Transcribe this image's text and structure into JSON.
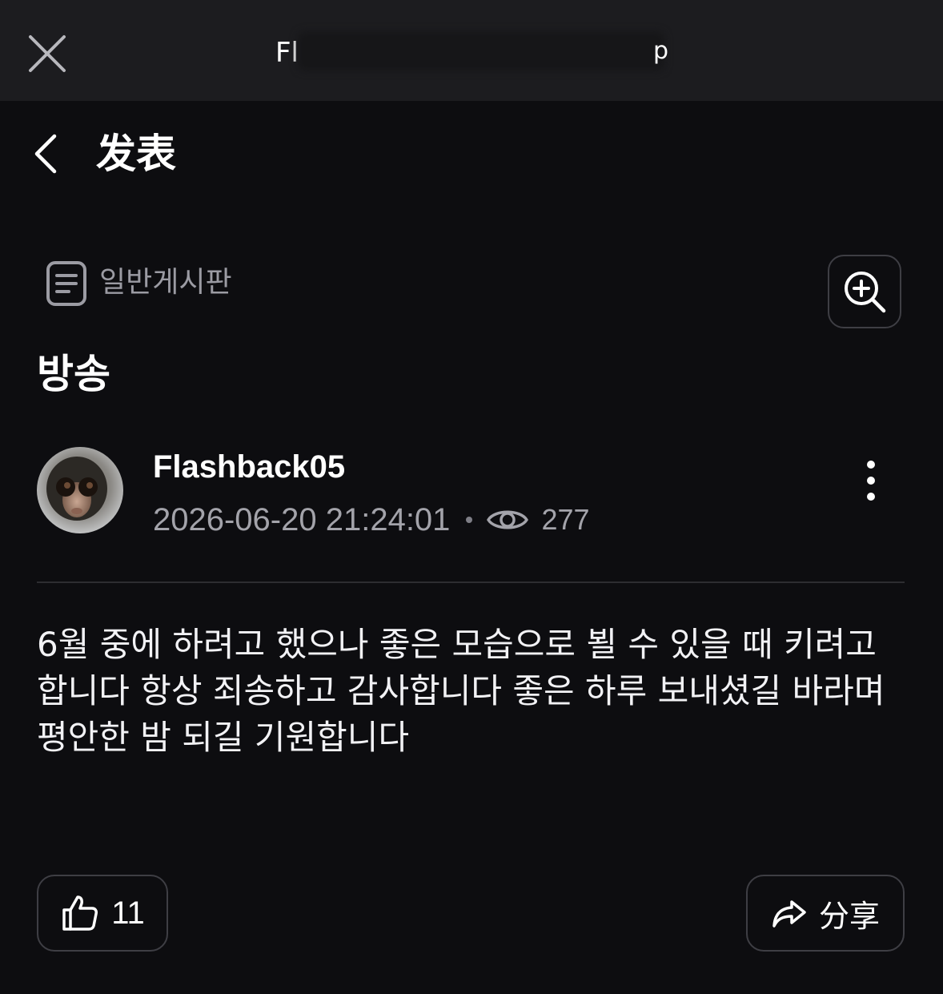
{
  "topbar": {
    "title_visible": "Fl",
    "title_tail": "p"
  },
  "header": {
    "title": "发表"
  },
  "board": {
    "name": "일반게시판"
  },
  "post": {
    "title": "방송",
    "author": "Flashback05",
    "timestamp": "2026-06-20 21:24:01",
    "views": "277",
    "body": "6월 중에 하려고 했으나 좋은 모습으로 뵐 수 있을 때 키려고 합니다 항상 죄송하고 감사합니다 좋은 하루 보내셨길 바라며 평안한 밤 되길 기원합니다",
    "likes": "11"
  },
  "actions": {
    "share_label": "分享"
  },
  "icons": {
    "close": "close-icon",
    "back": "chevron-left-icon",
    "board": "document-icon",
    "zoom": "zoom-in-icon",
    "views": "eye-icon",
    "more": "more-vertical-icon",
    "like": "thumbs-up-icon",
    "share": "share-arrow-icon"
  },
  "colors": {
    "background": "#0d0d10",
    "topbar": "#1c1c1f",
    "muted_text": "#9b9ba3",
    "border": "#3e3e44"
  }
}
